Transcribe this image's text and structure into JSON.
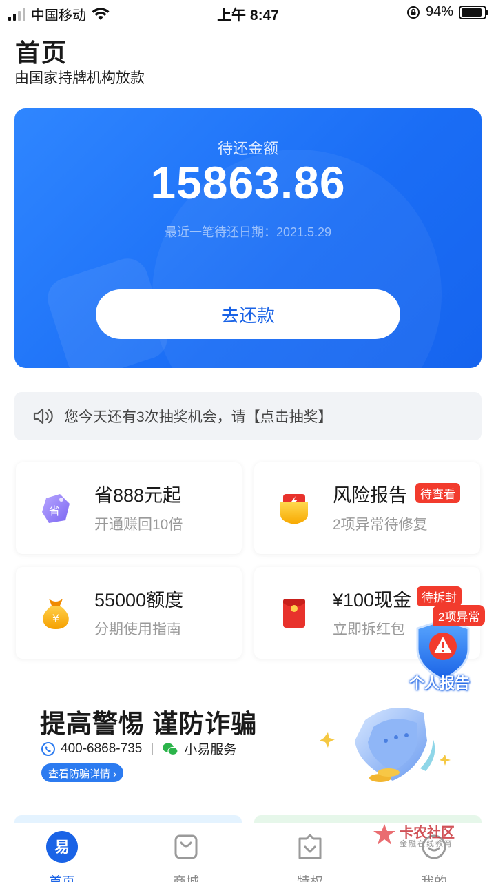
{
  "status_bar": {
    "carrier": "中国移动",
    "time": "上午 8:47",
    "battery": "94%"
  },
  "header": {
    "title": "首页",
    "subtitle": "由国家持牌机构放款"
  },
  "hero": {
    "label": "待还金额",
    "amount": "15863.86",
    "recent_due": "最近一笔待还日期：2021.5.29",
    "repay_button": "去还款"
  },
  "notice": {
    "text": "您今天还有3次抽奖机会，请【点击抽奖】"
  },
  "cards": [
    {
      "title": "省888元起",
      "subtitle": "开通赚回10倍",
      "icon": "discount-tag-icon",
      "tag": ""
    },
    {
      "title": "风险报告",
      "subtitle": "2项异常待修复",
      "icon": "risk-report-icon",
      "tag": "待查看"
    },
    {
      "title": "55000额度",
      "subtitle": "分期使用指南",
      "icon": "money-bag-icon",
      "tag": ""
    },
    {
      "title": "¥100现金",
      "subtitle": "立即拆红包",
      "icon": "red-envelope-icon",
      "tag": "待拆封"
    }
  ],
  "float_report": {
    "badge": "2项异常",
    "label": "个人报告"
  },
  "fraud": {
    "title": "提高警惕  谨防诈骗",
    "phone": "400-6868-735",
    "separator": "|",
    "wechat": "小易服务",
    "link": "查看防骗详情 ›"
  },
  "tabs": [
    {
      "label": "首页",
      "icon": "home-yi-icon",
      "active": true
    },
    {
      "label": "商城",
      "icon": "shopping-bag-icon",
      "active": false
    },
    {
      "label": "特权",
      "icon": "privilege-icon",
      "active": false
    },
    {
      "label": "我的",
      "icon": "profile-icon",
      "active": false
    }
  ],
  "watermark": {
    "name": "卡农社区",
    "tagline": "金融在线教育"
  },
  "colors": {
    "primary": "#1a6df5",
    "alert": "#f23b2d",
    "muted": "#9a9a9a"
  }
}
